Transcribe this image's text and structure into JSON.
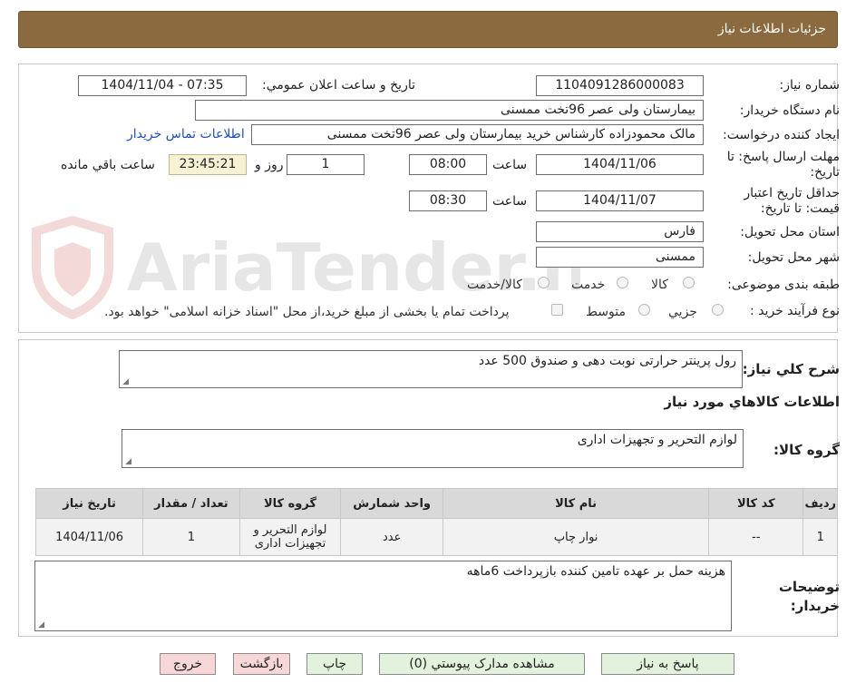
{
  "header": {
    "title": "جزئيات اطلاعات نياز"
  },
  "watermark": {
    "text": "AriaTender.neT"
  },
  "form": {
    "need_number_label": "شماره نياز:",
    "need_number": "1104091286000083",
    "announce_label": "تاريخ و ساعت اعلان عمومي:",
    "announce_value": "1404/11/04 - 07:35",
    "buyer_org_label": "نام دستگاه خريدار:",
    "buyer_org": "بیمارستان ولی عصر  96تخت ممسنی",
    "requester_label": "ايجاد کننده درخواست:",
    "requester": "مالک محمودزاده کارشناس خرید بیمارستان ولی عصر  96تخت ممسنی",
    "contact_link": "اطلاعات تماس خريدار",
    "deadline_label": "مهلت ارسال پاسخ: تا تاريخ:",
    "deadline_date": "1404/11/06",
    "time_label": "ساعت",
    "deadline_time": "08:00",
    "days_value": "1",
    "days_label": "روز و",
    "remaining_time": "23:45:21",
    "remaining_label": "ساعت باقي مانده",
    "validity_label": "حداقل تاريخ اعتبار قيمت: تا تاريخ:",
    "validity_date": "1404/11/07",
    "validity_time": "08:30",
    "province_label": "استان محل تحويل:",
    "province": "فارس",
    "city_label": "شهر محل تحويل:",
    "city": "ممسنی",
    "category_label": "طبقه بندی موضوعی:",
    "category_options": [
      "کالا",
      "خدمت",
      "کالا/خدمت"
    ],
    "process_label": "نوع فرآيند خريد :",
    "process_options": [
      "جزيي",
      "متوسط"
    ],
    "payment_note": "پرداخت تمام يا بخشی از مبلغ خريد،از محل \"اسناد خزانه اسلامی\" خواهد بود."
  },
  "summary": {
    "general_desc_label": "شرح کلي نياز:",
    "general_desc": "رول پرینتر حرارتی نوبت دهی و صندوق 500 عدد",
    "goods_info_title": "اطلاعات کالاهاي مورد نياز",
    "goods_group_label": "گروه کالا:",
    "goods_group": "لوازم التحرير و تجهيزات اداری"
  },
  "table": {
    "headers": [
      "رديف",
      "کد کالا",
      "نام کالا",
      "واحد شمارش",
      "گروه کالا",
      "تعداد / مقدار",
      "تاريخ نياز"
    ],
    "rows": [
      [
        "1",
        "--",
        "نوار چاپ",
        "عدد",
        "لوازم التحرير و تجهيزات اداری",
        "1",
        "1404/11/06"
      ]
    ]
  },
  "buyer_notes": {
    "label": "توضيحات خريدار:",
    "text": "هزینه حمل بر عهده تامین کننده بازپرداخت 6ماهه"
  },
  "buttons": {
    "reply": "پاسخ به نياز",
    "attachments": "مشاهده مدارک پيوستي (0)",
    "print": "چاپ",
    "back": "بازگشت",
    "exit": "خروج"
  },
  "colors": {
    "header_bg": "#8a6a3e",
    "remaining_bg": "#f6f2d3",
    "reply_bg": "#e3f2dc",
    "back_bg": "#f7d7d7",
    "link": "#1f4fb3"
  }
}
